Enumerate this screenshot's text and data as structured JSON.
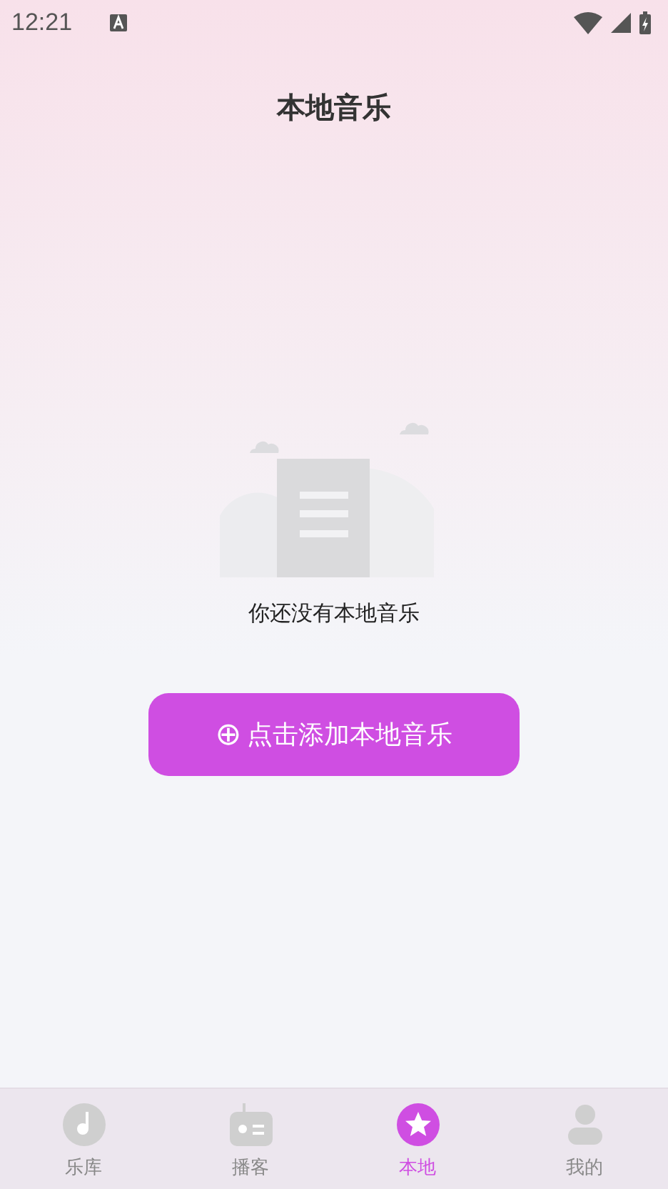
{
  "status_bar": {
    "time": "12:21"
  },
  "title": "本地音乐",
  "empty_state": {
    "message": "你还没有本地音乐"
  },
  "add_button": {
    "icon": "⊕",
    "label": "点击添加本地音乐"
  },
  "tabs": [
    {
      "kind": "disc",
      "label": "乐库",
      "selected": false
    },
    {
      "kind": "radio",
      "label": "播客",
      "selected": false
    },
    {
      "kind": "star",
      "label": "本地",
      "selected": true
    },
    {
      "kind": "person",
      "label": "我的",
      "selected": false
    }
  ]
}
